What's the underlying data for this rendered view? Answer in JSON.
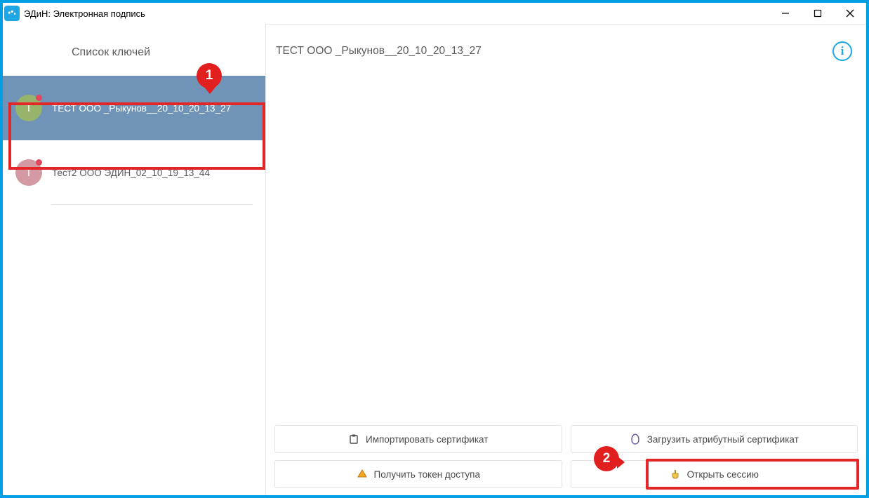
{
  "window": {
    "title": "ЭДиН: Электронная подпись"
  },
  "sidebar": {
    "header": "Список ключей",
    "items": [
      {
        "avatar_letter": "Т",
        "label": "ТЕСТ ООО _Рыкунов__20_10_20_13_27",
        "selected": true,
        "avatar_color": "#97b36c"
      },
      {
        "avatar_letter": "Т",
        "label": "Тест2 ООО ЭДИН_02_10_19_13_44",
        "selected": false,
        "avatar_color": "#d39aa3"
      }
    ]
  },
  "main": {
    "title": "ТЕСТ ООО _Рыкунов__20_10_20_13_27"
  },
  "actions": {
    "import_cert": "Импортировать сертификат",
    "load_attr_cert": "Загрузить атрибутный сертификат",
    "get_token": "Получить токен доступа",
    "open_session": "Открыть сессию"
  },
  "annotations": {
    "step1": "1",
    "step2": "2"
  },
  "colors": {
    "window_border": "#009fe3",
    "selected_bg": "#6f94b7",
    "highlight": "#e32627",
    "callout": "#e11f1f",
    "info": "#1ea7e4"
  }
}
